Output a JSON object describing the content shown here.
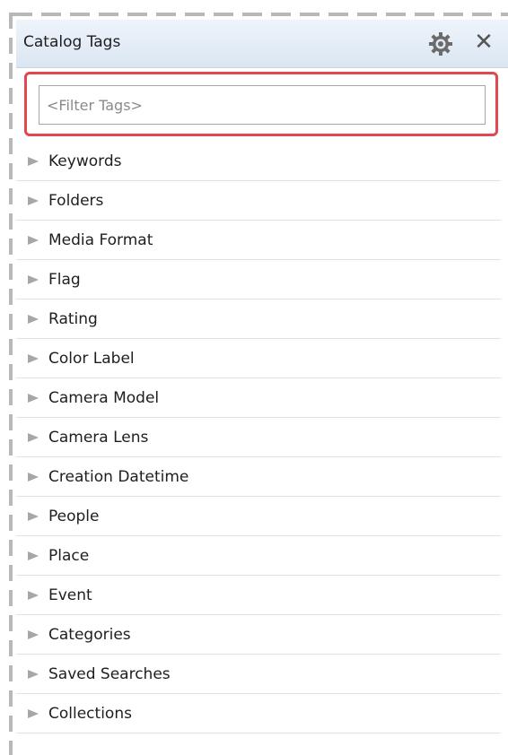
{
  "panel": {
    "title": "Catalog Tags",
    "settings_icon": "gear-icon",
    "close_icon": "close-icon",
    "close_glyph": "✕",
    "filter_placeholder": "<Filter Tags>",
    "highlight_color": "#e0474f"
  },
  "tags": [
    {
      "label": "Keywords"
    },
    {
      "label": "Folders"
    },
    {
      "label": "Media Format"
    },
    {
      "label": "Flag"
    },
    {
      "label": "Rating"
    },
    {
      "label": "Color Label"
    },
    {
      "label": "Camera Model"
    },
    {
      "label": "Camera Lens"
    },
    {
      "label": "Creation Datetime"
    },
    {
      "label": "People"
    },
    {
      "label": "Place"
    },
    {
      "label": "Event"
    },
    {
      "label": "Categories"
    },
    {
      "label": "Saved Searches"
    },
    {
      "label": "Collections"
    }
  ]
}
